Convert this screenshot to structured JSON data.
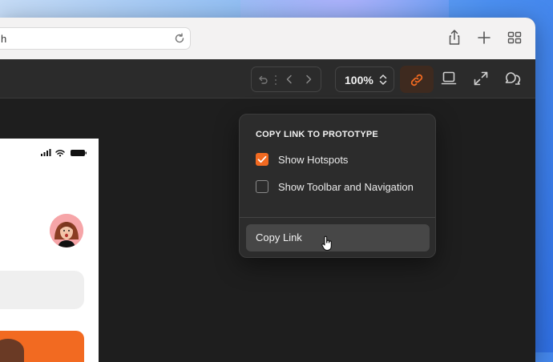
{
  "browser": {
    "url_fragment": "h"
  },
  "toolbar": {
    "zoom_level": "100%"
  },
  "popover": {
    "title": "COPY LINK TO PROTOTYPE",
    "options": [
      {
        "label": "Show Hotspots",
        "checked": true
      },
      {
        "label": "Show Toolbar and Navigation",
        "checked": false
      }
    ],
    "copy_button_label": "Copy Link"
  },
  "colors": {
    "accent": "#f26a21",
    "toolbar_bg": "#2b2b2b",
    "canvas_bg": "#1e1e1e",
    "popover_bg": "#2c2c2c",
    "browser_bar_bg": "#f3f2f2"
  },
  "icons": {
    "browser": [
      "reload-icon",
      "share-icon",
      "new-tab-icon",
      "tab-overview-icon"
    ],
    "toolbar": [
      "undo-icon",
      "chevron-left-icon",
      "chevron-right-icon",
      "zoom-stepper-icon",
      "link-icon",
      "device-icon",
      "fullscreen-icon",
      "comments-icon"
    ]
  }
}
